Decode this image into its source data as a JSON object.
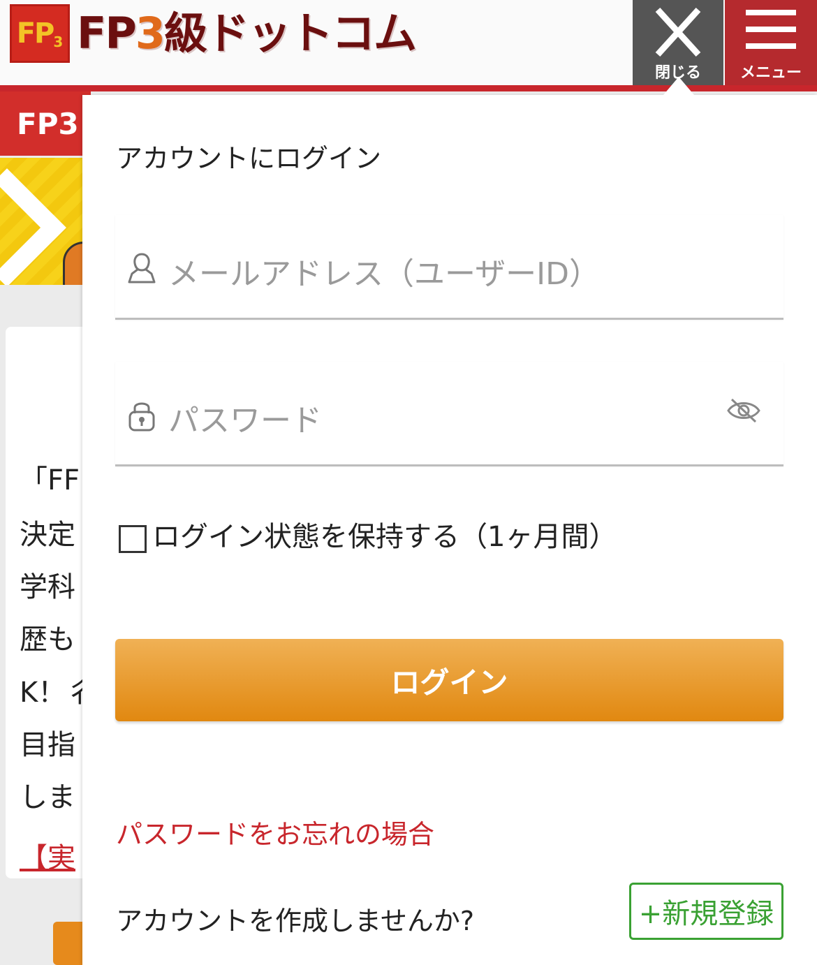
{
  "header": {
    "logo_badge": "FP",
    "logo_badge_sub": "3",
    "logo_text_a": "FP",
    "logo_text_three": "3",
    "logo_text_b": "級ドットコム",
    "close_label": "閉じる",
    "menu_label": "メニュー",
    "colors": {
      "accent_red": "#c8262c",
      "close_bg": "#555555",
      "menu_bg": "#b52a2e"
    }
  },
  "background_page": {
    "banner_text": "FP3",
    "lines": [
      "「FF",
      "決定",
      "学科",
      "歴も",
      "K！彳",
      "目指",
      "しま"
    ],
    "link_text": "【実"
  },
  "login": {
    "title": "アカウントにログイン",
    "email_placeholder": "メールアドレス（ユーザーID）",
    "password_placeholder": "パスワード",
    "remember_label": "ログイン状態を保持する（1ヶ月間）",
    "login_button": "ログイン",
    "forgot_link": "パスワードをお忘れの場合",
    "create_account_question": "アカウントを作成しませんか?",
    "signup_button": "+新規登録",
    "icons": {
      "email": "user-icon",
      "password": "lock-icon",
      "toggle": "eye-slash-icon"
    },
    "colors": {
      "button": "#e18810",
      "link": "#c8262c",
      "signup": "#3aa133"
    }
  }
}
